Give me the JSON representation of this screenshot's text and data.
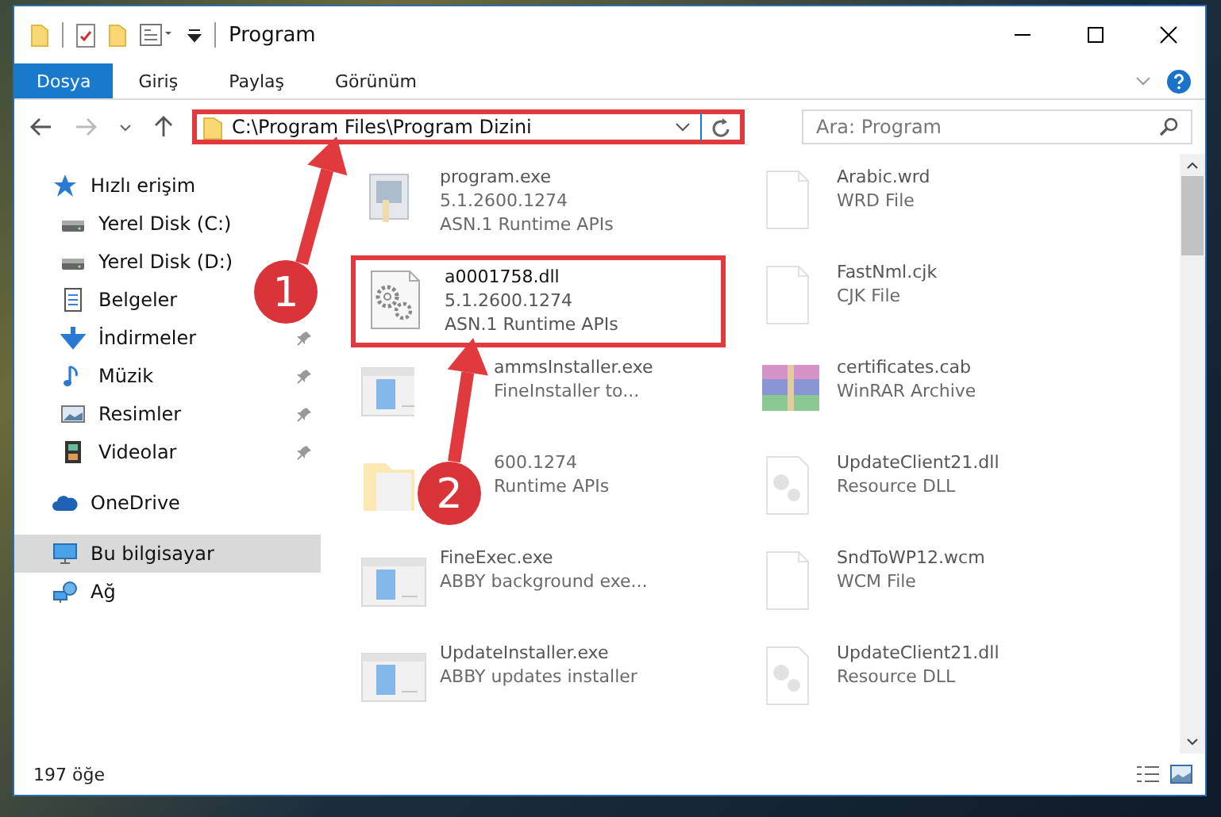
{
  "window": {
    "title": "Program"
  },
  "ribbon_tabs": [
    {
      "label": "Dosya",
      "selected": true
    },
    {
      "label": "Giriş",
      "selected": false
    },
    {
      "label": "Paylaş",
      "selected": false
    },
    {
      "label": "Görünüm",
      "selected": false
    }
  ],
  "address_bar": {
    "value": "C:\\Program Files\\Program Dizini",
    "highlighted": true
  },
  "search": {
    "placeholder": "Ara: Program"
  },
  "sidebar": {
    "items": [
      {
        "label": "Hızlı erişim",
        "kind": "star",
        "pinned": false,
        "selected": false,
        "children": [
          {
            "label": "Yerel Disk (C:)",
            "kind": "drive",
            "pinned": false,
            "selected": false
          },
          {
            "label": "Yerel Disk (D:)",
            "kind": "drive",
            "pinned": false,
            "selected": false
          },
          {
            "label": "Belgeler",
            "kind": "document",
            "pinned": false,
            "selected": false
          },
          {
            "label": "İndirmeler",
            "kind": "download",
            "pinned": true,
            "selected": false
          },
          {
            "label": "Müzik",
            "kind": "music",
            "pinned": true,
            "selected": false
          },
          {
            "label": "Resimler",
            "kind": "picture",
            "pinned": true,
            "selected": false
          },
          {
            "label": "Videolar",
            "kind": "film",
            "pinned": true,
            "selected": false
          }
        ]
      },
      {
        "label": "OneDrive",
        "kind": "cloud",
        "pinned": false,
        "selected": false
      },
      {
        "label": "Bu bilgisayar",
        "kind": "monitor",
        "pinned": false,
        "selected": true
      },
      {
        "label": "Ağ",
        "kind": "network",
        "pinned": false,
        "selected": false
      }
    ]
  },
  "files": [
    {
      "kind": "program",
      "name": "program.exe",
      "line_2": "5.1.2600.1274",
      "line_3": "ASN.1 Runtime APIs",
      "dimmed": true,
      "highlighted": false,
      "partly_covered": false
    },
    {
      "kind": "generic",
      "name": "Arabic.wrd",
      "line_2": "WRD File",
      "dimmed": true,
      "highlighted": false,
      "partly_covered": false
    },
    {
      "kind": "settings",
      "name": "a0001758.dll",
      "line_2": "5.1.2600.1274",
      "line_3": "ASN.1 Runtime APIs",
      "dimmed": false,
      "highlighted": true,
      "partly_covered": false
    },
    {
      "kind": "generic",
      "name": "FastNml.cjk",
      "line_2": "CJK File",
      "dimmed": true,
      "highlighted": false,
      "partly_covered": false
    },
    {
      "kind": "installer",
      "name": "ammsInstaller.exe",
      "line_2": "FineInstaller to...",
      "dimmed": true,
      "highlighted": false,
      "partly_covered": true
    },
    {
      "kind": "archive",
      "name": "certificates.cab",
      "line_2": "WinRAR Archive",
      "dimmed": true,
      "highlighted": false,
      "partly_covered": false
    },
    {
      "kind": "folder",
      "line_2": "600.1274",
      "line_3": "Runtime APIs",
      "dimmed": true,
      "highlighted": false,
      "partly_covered": true
    },
    {
      "kind": "library",
      "name": "UpdateClient21.dll",
      "line_2": "Resource DLL",
      "dimmed": true,
      "highlighted": false,
      "partly_covered": false
    },
    {
      "kind": "installer",
      "name": "FineExec.exe",
      "line_2": "ABBY background exe...",
      "dimmed": true,
      "highlighted": false,
      "partly_covered": false
    },
    {
      "kind": "generic",
      "name": "SndToWP12.wcm",
      "line_2": "WCM File",
      "dimmed": true,
      "highlighted": false,
      "partly_covered": false
    },
    {
      "kind": "installer",
      "name": "UpdateInstaller.exe",
      "line_2": "ABBY updates installer",
      "dimmed": true,
      "highlighted": false,
      "partly_covered": false
    },
    {
      "kind": "library",
      "name": "UpdateClient21.dll",
      "line_2": "Resource DLL",
      "dimmed": true,
      "highlighted": false,
      "partly_covered": false
    }
  ],
  "status_bar": {
    "item_count": "197 öğe"
  },
  "annotations": [
    {
      "number": "1"
    },
    {
      "number": "2"
    }
  ]
}
